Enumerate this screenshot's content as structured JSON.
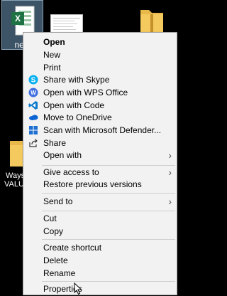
{
  "desktop": {
    "excel_file_label": "new",
    "folder_left_label_line1": "Ways",
    "folder_left_label_line2": "VALUE"
  },
  "context_menu": {
    "items": [
      {
        "label": "Open",
        "bold": true,
        "icon": ""
      },
      {
        "label": "New",
        "icon": ""
      },
      {
        "label": "Print",
        "icon": ""
      },
      {
        "label": "Share with Skype",
        "icon": "skype-icon"
      },
      {
        "label": "Open with WPS Office",
        "icon": "wps-office-icon"
      },
      {
        "label": "Open with Code",
        "icon": "vscode-icon"
      },
      {
        "label": "Move to OneDrive",
        "icon": "onedrive-icon"
      },
      {
        "label": "Scan with Microsoft Defender...",
        "icon": "defender-icon"
      },
      {
        "label": "Share",
        "icon": "share-icon"
      },
      {
        "label": "Open with",
        "submenu": true
      },
      {
        "label": "Give access to",
        "submenu": true
      },
      {
        "label": "Restore previous versions"
      },
      {
        "label": "Send to",
        "submenu": true
      },
      {
        "label": "Cut"
      },
      {
        "label": "Copy"
      },
      {
        "label": "Create shortcut"
      },
      {
        "label": "Delete"
      },
      {
        "label": "Rename"
      },
      {
        "label": "Properties"
      }
    ]
  },
  "colors": {
    "skype": "#00aff0",
    "wps": "#3f6fe0",
    "vscode": "#0a7acc",
    "onedrive": "#0a64d2",
    "defender": "#1f6fd1",
    "excel_green": "#1f7244"
  }
}
